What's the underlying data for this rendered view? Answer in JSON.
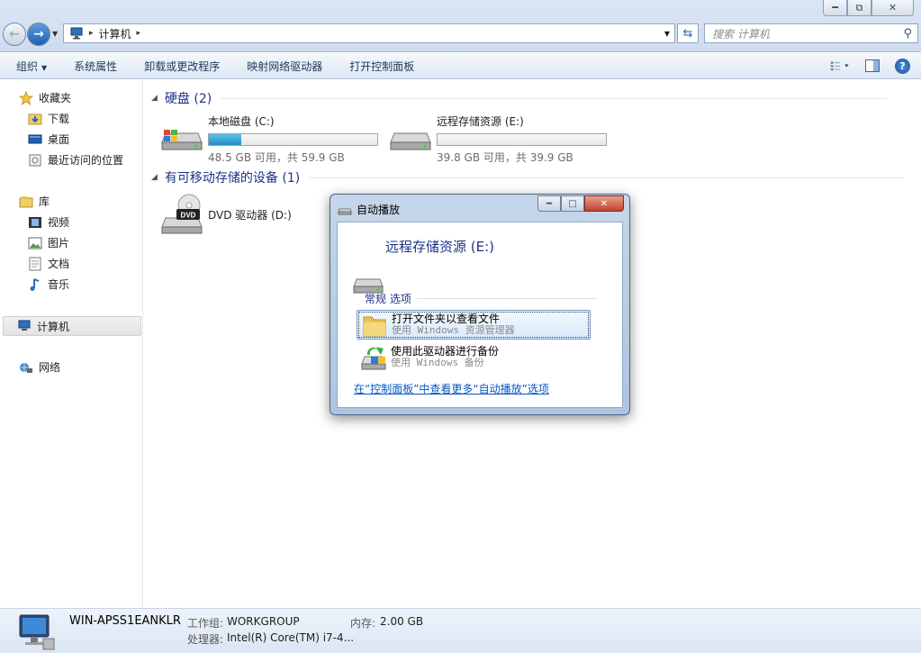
{
  "window": {
    "minimize_label": "━",
    "maximize_label": "⧉",
    "close_label": "✕"
  },
  "address_bar": {
    "root_separator": "▸",
    "path": [
      "计算机"
    ],
    "path_separator": "▸"
  },
  "search": {
    "placeholder": "搜索 计算机"
  },
  "toolbar": {
    "organize": "组织",
    "items": [
      "系统属性",
      "卸载或更改程序",
      "映射网络驱动器",
      "打开控制面板"
    ]
  },
  "sidebar": {
    "favorites": {
      "label": "收藏夹",
      "items": [
        "下载",
        "桌面",
        "最近访问的位置"
      ]
    },
    "libraries": {
      "label": "库",
      "items": [
        "视频",
        "图片",
        "文档",
        "音乐"
      ]
    },
    "computer": "计算机",
    "network": "网络"
  },
  "main": {
    "hard_disks": {
      "title": "硬盘 (2)",
      "drives": [
        {
          "name": "本地磁盘 (C:)",
          "free_text": "48.5 GB 可用，共 59.9 GB",
          "used_fraction": 0.19
        },
        {
          "name": "远程存储资源 (E:)",
          "free_text": "39.8 GB 可用，共 39.9 GB",
          "used_fraction": 0.0
        }
      ]
    },
    "removable": {
      "title": "有可移动存储的设备 (1)",
      "drives": [
        {
          "name": "DVD 驱动器 (D:)",
          "badge": "DVD"
        }
      ]
    }
  },
  "dialog": {
    "title": "自动播放",
    "drive_name": "远程存储资源 (E:)",
    "section": "常规 选项",
    "options": [
      {
        "title": "打开文件夹以查看文件",
        "subtitle": "使用 Windows 资源管理器"
      },
      {
        "title": "使用此驱动器进行备份",
        "subtitle": "使用 Windows 备份"
      }
    ],
    "link": "在“控制面板”中查看更多“自动播放”选项"
  },
  "details": {
    "computer_name": "WIN-APSS1EANKLR",
    "workgroup_label": "工作组:",
    "workgroup": "WORKGROUP",
    "memory_label": "内存:",
    "memory": "2.00 GB",
    "processor_label": "处理器:",
    "processor": "Intel(R) Core(TM) i7-4..."
  },
  "colors": {
    "accent": "#1e3287",
    "bar_fill": "#26a0da",
    "link": "#0b57c4"
  }
}
